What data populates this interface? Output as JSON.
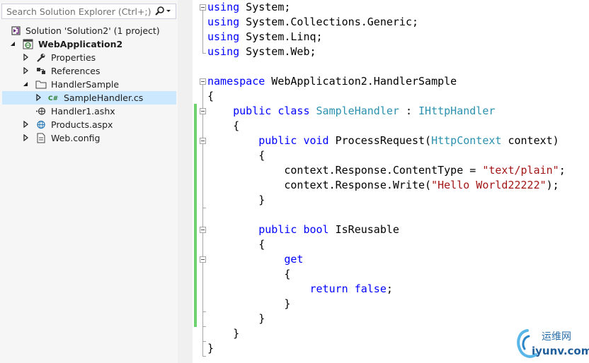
{
  "explorer": {
    "search_placeholder": "Search Solution Explorer (Ctrl+;)",
    "items": [
      {
        "label": "Solution 'Solution2' (1 project)",
        "icon": "solution-icon"
      },
      {
        "label": "WebApplication2",
        "icon": "web-project-icon"
      },
      {
        "label": "Properties",
        "icon": "wrench-icon"
      },
      {
        "label": "References",
        "icon": "references-icon"
      },
      {
        "label": "HandlerSample",
        "icon": "folder-icon"
      },
      {
        "label": "SampleHandler.cs",
        "icon": "csharp-file-icon"
      },
      {
        "label": "Handler1.ashx",
        "icon": "handler-file-icon"
      },
      {
        "label": "Products.aspx",
        "icon": "aspx-file-icon"
      },
      {
        "label": "Web.config",
        "icon": "config-file-icon"
      }
    ]
  },
  "code": {
    "lines": [
      [
        {
          "t": "using",
          "c": "kw"
        },
        {
          "t": " System;"
        }
      ],
      [
        {
          "t": "using",
          "c": "kw"
        },
        {
          "t": " System.Collections.Generic;"
        }
      ],
      [
        {
          "t": "using",
          "c": "kw"
        },
        {
          "t": " System.Linq;"
        }
      ],
      [
        {
          "t": "using",
          "c": "kw"
        },
        {
          "t": " System.Web;"
        }
      ],
      [],
      [
        {
          "t": "namespace",
          "c": "kw"
        },
        {
          "t": " WebApplication2.HandlerSample"
        }
      ],
      [
        {
          "t": "{"
        }
      ],
      [
        {
          "t": "    "
        },
        {
          "t": "public",
          "c": "kw"
        },
        {
          "t": " "
        },
        {
          "t": "class",
          "c": "kw"
        },
        {
          "t": " "
        },
        {
          "t": "SampleHandler",
          "c": "ty"
        },
        {
          "t": " : "
        },
        {
          "t": "IHttpHandler",
          "c": "ty"
        }
      ],
      [
        {
          "t": "    {"
        }
      ],
      [
        {
          "t": "        "
        },
        {
          "t": "public",
          "c": "kw"
        },
        {
          "t": " "
        },
        {
          "t": "void",
          "c": "kw"
        },
        {
          "t": " ProcessRequest("
        },
        {
          "t": "HttpContext",
          "c": "ty"
        },
        {
          "t": " context)"
        }
      ],
      [
        {
          "t": "        {"
        }
      ],
      [
        {
          "t": "            context.Response.ContentType = "
        },
        {
          "t": "\"text/plain\"",
          "c": "st"
        },
        {
          "t": ";"
        }
      ],
      [
        {
          "t": "            context.Response.Write("
        },
        {
          "t": "\"Hello World22222\"",
          "c": "st"
        },
        {
          "t": ");"
        }
      ],
      [
        {
          "t": "        }"
        }
      ],
      [],
      [
        {
          "t": "        "
        },
        {
          "t": "public",
          "c": "kw"
        },
        {
          "t": " "
        },
        {
          "t": "bool",
          "c": "kw"
        },
        {
          "t": " IsReusable"
        }
      ],
      [
        {
          "t": "        {"
        }
      ],
      [
        {
          "t": "            "
        },
        {
          "t": "get",
          "c": "kw"
        }
      ],
      [
        {
          "t": "            {"
        }
      ],
      [
        {
          "t": "                "
        },
        {
          "t": "return",
          "c": "kw"
        },
        {
          "t": " "
        },
        {
          "t": "false",
          "c": "kw"
        },
        {
          "t": ";"
        }
      ],
      [
        {
          "t": "            }"
        }
      ],
      [
        {
          "t": "        }"
        }
      ],
      [
        {
          "t": "    }"
        }
      ],
      [
        {
          "t": "}"
        }
      ]
    ]
  },
  "watermark": {
    "name_cn": "运维网",
    "url": "iyunv.com"
  },
  "colors": {
    "keyword": "#0000ff",
    "type": "#2b91af",
    "string": "#a31515",
    "selection": "#cce8ff",
    "change_bar": "#6ed36e"
  }
}
